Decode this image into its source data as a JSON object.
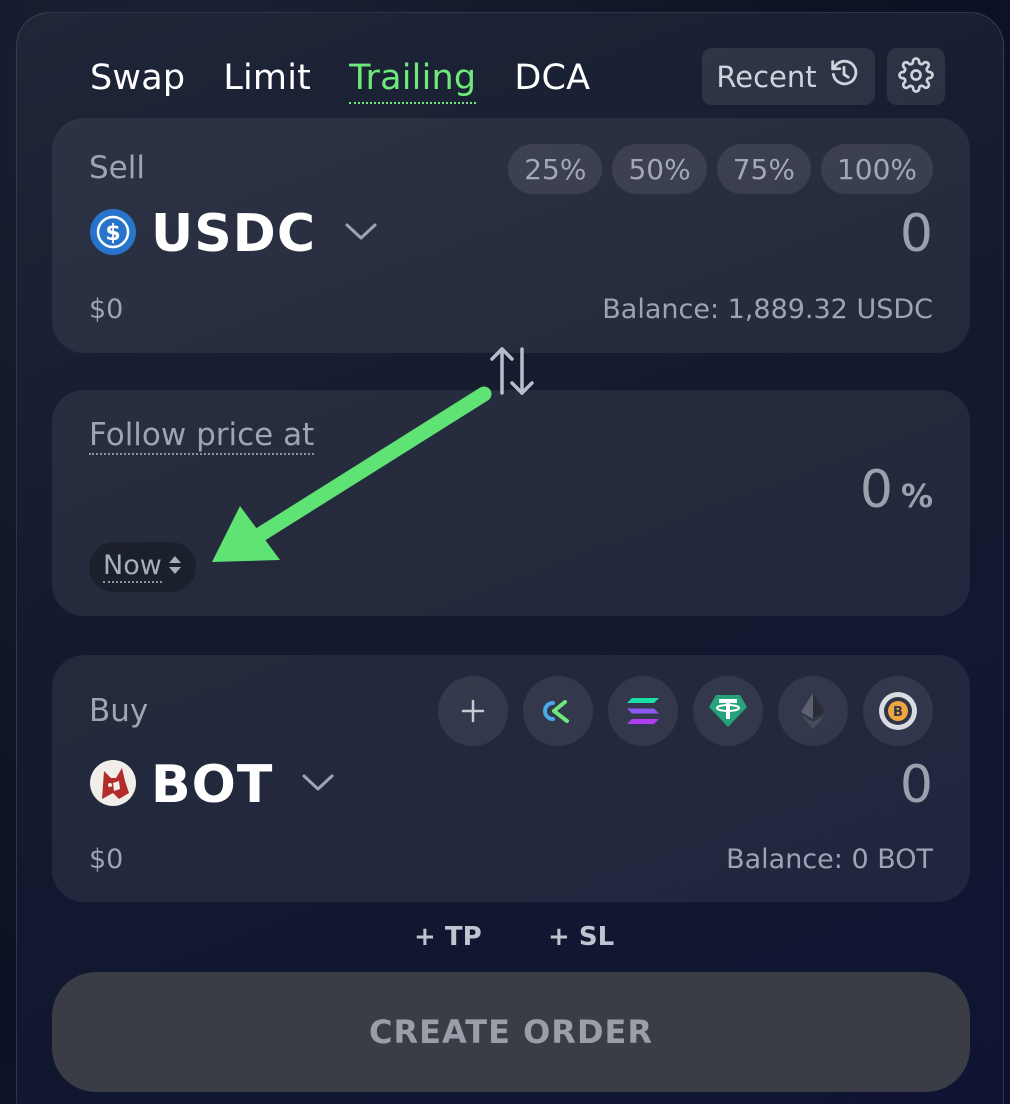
{
  "tabs": [
    {
      "label": "Swap"
    },
    {
      "label": "Limit"
    },
    {
      "label": "Trailing",
      "active": true
    },
    {
      "label": "DCA"
    }
  ],
  "header": {
    "recent_label": "Recent"
  },
  "sell": {
    "label": "Sell",
    "percent_buttons": [
      "25%",
      "50%",
      "75%",
      "100%"
    ],
    "token": "USDC",
    "token_icon": "usdc-icon",
    "amount": "0",
    "usd_value": "$0",
    "balance": "Balance: 1,889.32 USDC"
  },
  "follow": {
    "label": "Follow price at",
    "value": "0",
    "unit": "%",
    "timing": "Now"
  },
  "buy": {
    "label": "Buy",
    "token": "BOT",
    "token_icon": "bot-dog-icon",
    "amount": "0",
    "usd_value": "$0",
    "balance": "Balance: 0 BOT",
    "quick_tokens": [
      "add-token-icon",
      "ok-token-icon",
      "solana-icon",
      "tether-icon",
      "ethereum-icon",
      "bitcoin-icon"
    ]
  },
  "actions": {
    "tp": "+ TP",
    "sl": "+ SL",
    "create": "CREATE ORDER"
  },
  "colors": {
    "accent": "#6ee87a",
    "usdc": "#2775ca",
    "bot": "#b32b2b"
  }
}
